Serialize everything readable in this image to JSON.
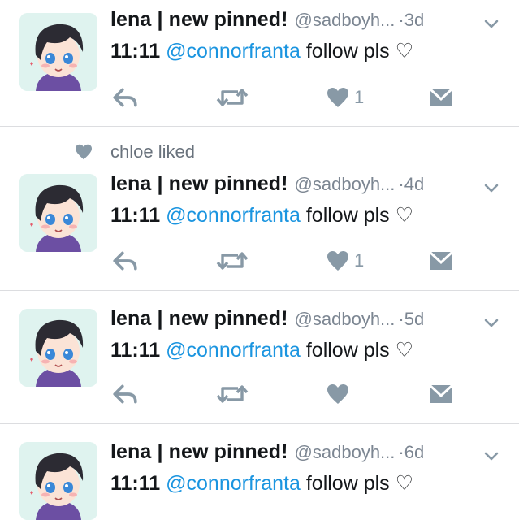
{
  "tweets": [
    {
      "display_name": "lena | new pinned!",
      "handle": "@sadboyh...",
      "separator": "·",
      "time": "3d",
      "body_time": "11:11",
      "mention": "@connorfranta",
      "body_rest": "follow pls ♡",
      "like_count": "1"
    },
    {
      "display_name": "lena | new pinned!",
      "handle": "@sadboyh...",
      "separator": "·",
      "time": "4d",
      "body_time": "11:11",
      "mention": "@connorfranta",
      "body_rest": "follow pls ♡",
      "like_count": "1",
      "liked_by": "chloe liked"
    },
    {
      "display_name": "lena | new pinned!",
      "handle": "@sadboyh...",
      "separator": "·",
      "time": "5d",
      "body_time": "11:11",
      "mention": "@connorfranta",
      "body_rest": "follow pls ♡",
      "like_count": ""
    },
    {
      "display_name": "lena | new pinned!",
      "handle": "@sadboyh...",
      "separator": "·",
      "time": "6d",
      "body_time": "11:11",
      "mention": "@connorfranta",
      "body_rest": "follow pls ♡"
    }
  ],
  "icons": {
    "reply": "reply-icon",
    "retweet": "retweet-icon",
    "like": "heart-icon",
    "dm": "envelope-icon",
    "menu": "chevron-down-icon"
  },
  "colors": {
    "link": "#1b95e0",
    "text": "#14171a",
    "muted": "#7c8692",
    "icon": "#8899a6",
    "divider": "#dcdde0"
  }
}
